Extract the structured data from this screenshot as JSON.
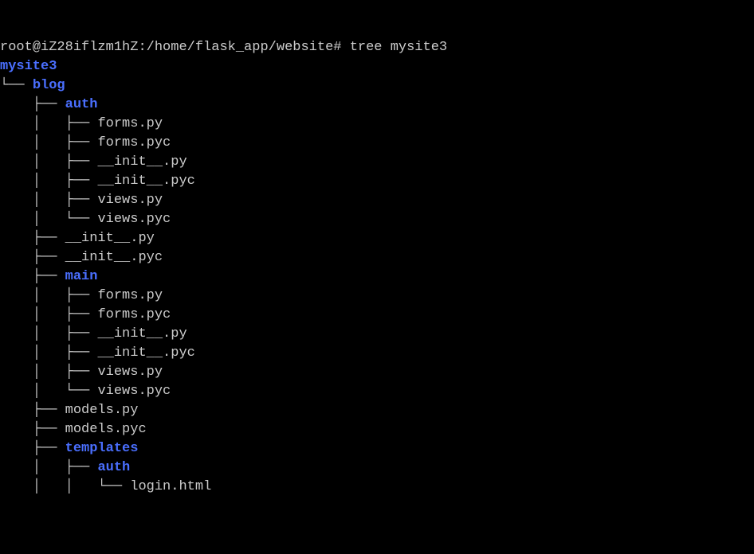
{
  "prompt": {
    "user_host": "root@iZ28iflzm1hZ",
    "path": "/home/flask_app/website",
    "symbol": "#",
    "command": "tree mysite3"
  },
  "tree": {
    "root": "mysite3",
    "l0": {
      "blog": "blog"
    },
    "blog": {
      "auth": "auth",
      "auth_files": {
        "f1": "forms.py",
        "f2": "forms.pyc",
        "f3": "__init__.py",
        "f4": "__init__.pyc",
        "f5": "views.py",
        "f6": "views.pyc"
      },
      "init_py": "__init__.py",
      "init_pyc": "__init__.pyc",
      "main": "main",
      "main_files": {
        "f1": "forms.py",
        "f2": "forms.pyc",
        "f3": "__init__.py",
        "f4": "__init__.pyc",
        "f5": "views.py",
        "f6": "views.pyc"
      },
      "models_py": "models.py",
      "models_pyc": "models.pyc",
      "templates": "templates",
      "templates_children": {
        "auth": "auth",
        "auth_files": {
          "login": "login.html"
        }
      }
    }
  },
  "branches": {
    "last": "└── ",
    "mid": "├── ",
    "pipe": "│   ",
    "space": "    "
  }
}
